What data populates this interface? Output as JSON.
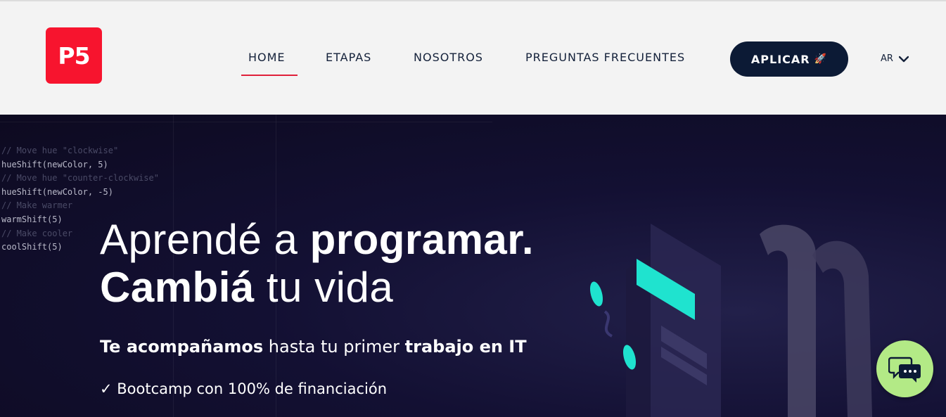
{
  "header": {
    "logo_text": "P5",
    "nav": {
      "home": "HOME",
      "etapas": "ETAPAS",
      "nosotros": "NOSOTROS",
      "faq": "PREGUNTAS FRECUENTES"
    },
    "apply_label": "APLICAR",
    "lang_label": "AR"
  },
  "hero": {
    "code_lines": [
      "// Move hue \"clockwise\"",
      "hueShift(newColor, 5)",
      "// Move hue \"counter-clockwise\"",
      "hueShift(newColor, -5)",
      "// Make warmer",
      "warmShift(5)",
      "// Make cooler",
      "coolShift(5)"
    ],
    "headline_line1_regular": "Aprendé a ",
    "headline_line1_bold": "programar.",
    "headline_line2_bold": "Cambiá",
    "headline_line2_regular": " tu vida",
    "sub_bold_1": "Te acompañamos",
    "sub_regular": " hasta tu primer ",
    "sub_bold_2": "trabajo en IT",
    "bullet": "✓ Bootcamp con 100% de financiación"
  },
  "colors": {
    "brand_red": "#f7142e",
    "navy": "#0c1a35",
    "accent_teal": "#1fe3cf",
    "chat_green": "#b3ea86"
  },
  "icons": {
    "rocket": "rocket-icon",
    "chevron": "chevron-down-icon",
    "chat": "chat-bubbles-icon"
  }
}
